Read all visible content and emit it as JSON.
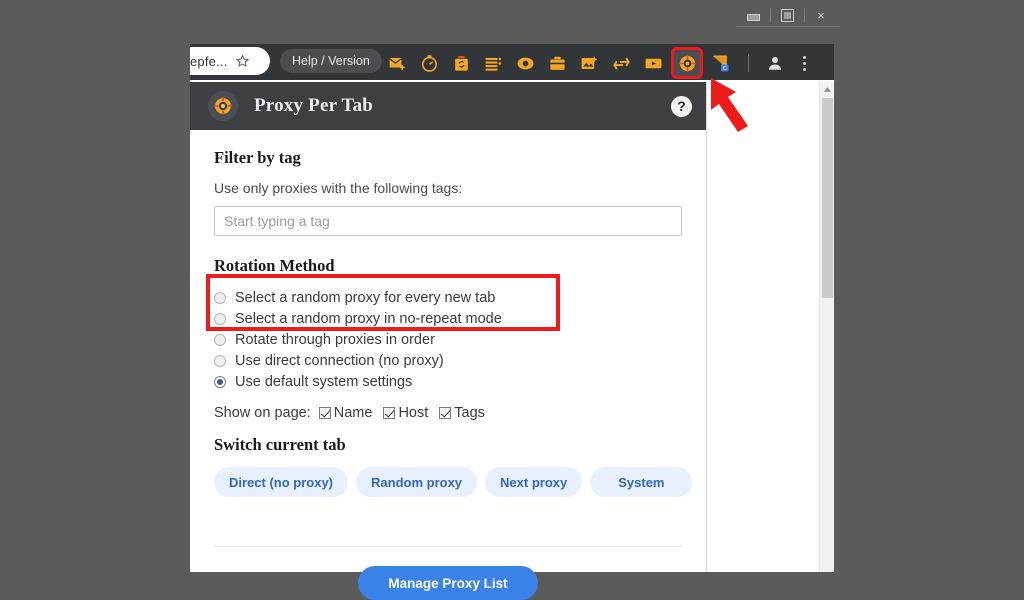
{
  "window": {
    "minimize_label": "minimize",
    "maximize_label": "maximize",
    "close_label": "×"
  },
  "browser": {
    "tab_title": "epfe...",
    "bookmark_icon": "star-icon",
    "help_version_label": "Help / Version",
    "extension_icons": [
      "mail-extension-icon",
      "timer-extension-icon",
      "trash-extension-icon",
      "list-extension-icon",
      "eye-extension-icon",
      "briefcase-extension-icon",
      "image-extension-icon",
      "recycle-extension-icon",
      "video-extension-icon",
      "proxy-per-tab-extension-icon"
    ],
    "highlighted_extension": "proxy-per-tab-extension-icon",
    "cast_icon": "cast-icon",
    "profile_icon": "profile-avatar-icon",
    "menu_icon": "three-dot-menu-icon"
  },
  "popup": {
    "logo_icon": "proxy-target-logo",
    "title": "Proxy Per Tab",
    "help_label": "?",
    "filter": {
      "heading": "Filter by tag",
      "description": "Use only proxies with the following tags:",
      "input_placeholder": "Start typing a tag",
      "input_value": ""
    },
    "rotation": {
      "heading": "Rotation Method",
      "options": [
        {
          "label": "Select a random proxy for every new tab",
          "selected": false
        },
        {
          "label": "Select a random proxy in no-repeat mode",
          "selected": false
        },
        {
          "label": "Rotate through proxies in order",
          "selected": false
        },
        {
          "label": "Use direct connection (no proxy)",
          "selected": false
        },
        {
          "label": "Use default system settings",
          "selected": true
        }
      ],
      "highlight_note": "red-box-around-first-three-options"
    },
    "show_on_page": {
      "label": "Show on page:",
      "checkboxes": [
        {
          "label": "Name",
          "checked": true
        },
        {
          "label": "Host",
          "checked": true
        },
        {
          "label": "Tags",
          "checked": true
        }
      ]
    },
    "switch_tab": {
      "heading": "Switch current tab",
      "buttons": [
        "Direct (no proxy)",
        "Random proxy",
        "Next proxy",
        "System"
      ]
    },
    "manage_button": "Manage Proxy List"
  },
  "annotations": {
    "arrow_color": "#ee1b1b",
    "highlight_color": "#ee1b1b"
  },
  "colors": {
    "page_background": "#5b5b5b",
    "toolbar": "#323639",
    "popup_header": "#3c4043",
    "accent_blue": "#3b82e8",
    "pill_blue_bg": "#e8f0fe",
    "pill_blue_text": "#3267c4",
    "extension_orange": "#f5a623"
  }
}
